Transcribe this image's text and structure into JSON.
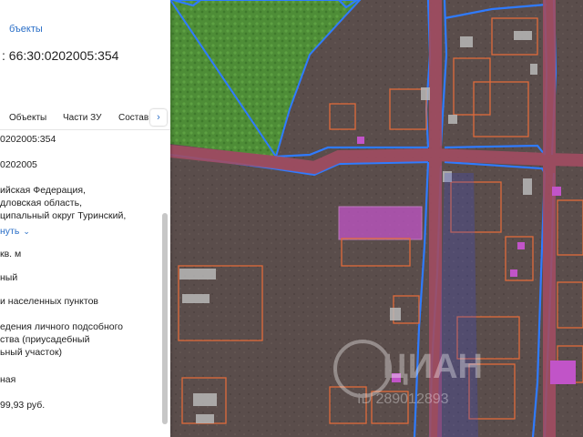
{
  "panel": {
    "objects_link": "бъекты",
    "cadastral_title": ": 66:30:0202005:354",
    "tabs": [
      "Объекты",
      "Части ЗУ",
      "Состав"
    ],
    "tab_next_label": "›",
    "rows": {
      "number": "0202005:354",
      "quarter": "0202005",
      "address_1": "ийская Федерация,",
      "address_2": "дловская область,",
      "address_3": "ципальный округ Туринский,",
      "expand": "нуть",
      "area": "кв. м",
      "status": "ный",
      "category": "и населенных пунктов",
      "use_1": "едения личного подсобного",
      "use_2": "ства (приусадебный",
      "use_3": "ьный участок)",
      "ownership": "ная",
      "cost": "99,93 руб."
    }
  },
  "map": {
    "watermark_brand": "ЦИАН",
    "watermark_id": "ID 289012893",
    "colors": {
      "background": "#5c4f4c",
      "field": "#4f8f37",
      "road": "#a14c62",
      "boundary_blue": "#2f7bff",
      "plot_orange": "#e06a3a",
      "selected_plot": "#c154c8"
    }
  }
}
